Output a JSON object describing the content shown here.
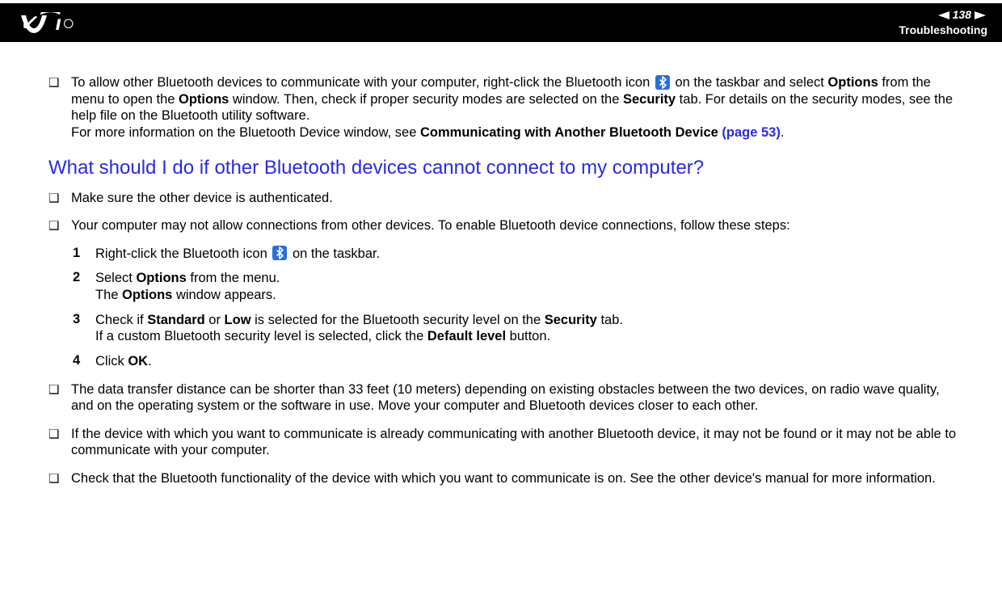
{
  "header": {
    "page_number": "138",
    "section": "Troubleshooting"
  },
  "bullets_top": [
    {
      "pre": "To allow other Bluetooth devices to communicate with your computer, right-click the Bluetooth icon ",
      "post_icon_1": " on the taskbar and select ",
      "b1": "Options",
      "mid1": " from the menu to open the ",
      "b2": "Options",
      "mid2": " window. Then, check if proper security modes are selected on the ",
      "b3": "Security",
      "mid3": " tab. For details on the security modes, see the help file on the Bluetooth utility software.",
      "line2_pre": "For more information on the Bluetooth Device window, see ",
      "line2_b": "Communicating with Another Bluetooth Device",
      "line2_link": " (page 53)",
      "line2_end": "."
    }
  ],
  "question": "What should I do if other Bluetooth devices cannot connect to my computer?",
  "bullets_q": {
    "b1": "Make sure the other device is authenticated.",
    "b2": "Your computer may not allow connections from other devices. To enable Bluetooth device connections, follow these steps:",
    "b3": "The data transfer distance can be shorter than 33 feet (10 meters) depending on existing obstacles between the two devices, on radio wave quality, and on the operating system or the software in use. Move your computer and Bluetooth devices closer to each other.",
    "b4": "If the device with which you want to communicate is already communicating with another Bluetooth device, it may not be found or it may not be able to communicate with your computer.",
    "b5": "Check that the Bluetooth functionality of the device with which you want to communicate is on. See the other device's manual for more information."
  },
  "steps": {
    "s1_pre": "Right-click the Bluetooth icon ",
    "s1_post": " on the taskbar.",
    "s2_a": "Select ",
    "s2_b": "Options",
    "s2_c": " from the menu.",
    "s2_d": "The ",
    "s2_e": "Options",
    "s2_f": " window appears.",
    "s3_a": "Check if ",
    "s3_b": "Standard",
    "s3_c": " or ",
    "s3_d": "Low",
    "s3_e": " is selected for the Bluetooth security level on the ",
    "s3_f": "Security",
    "s3_g": " tab.",
    "s3_h": "If a custom Bluetooth security level is selected, click the ",
    "s3_i": "Default level",
    "s3_j": " button.",
    "s4_a": "Click ",
    "s4_b": "OK",
    "s4_c": "."
  },
  "step_numbers": {
    "n1": "1",
    "n2": "2",
    "n3": "3",
    "n4": "4"
  },
  "bullet_mark": "❑"
}
